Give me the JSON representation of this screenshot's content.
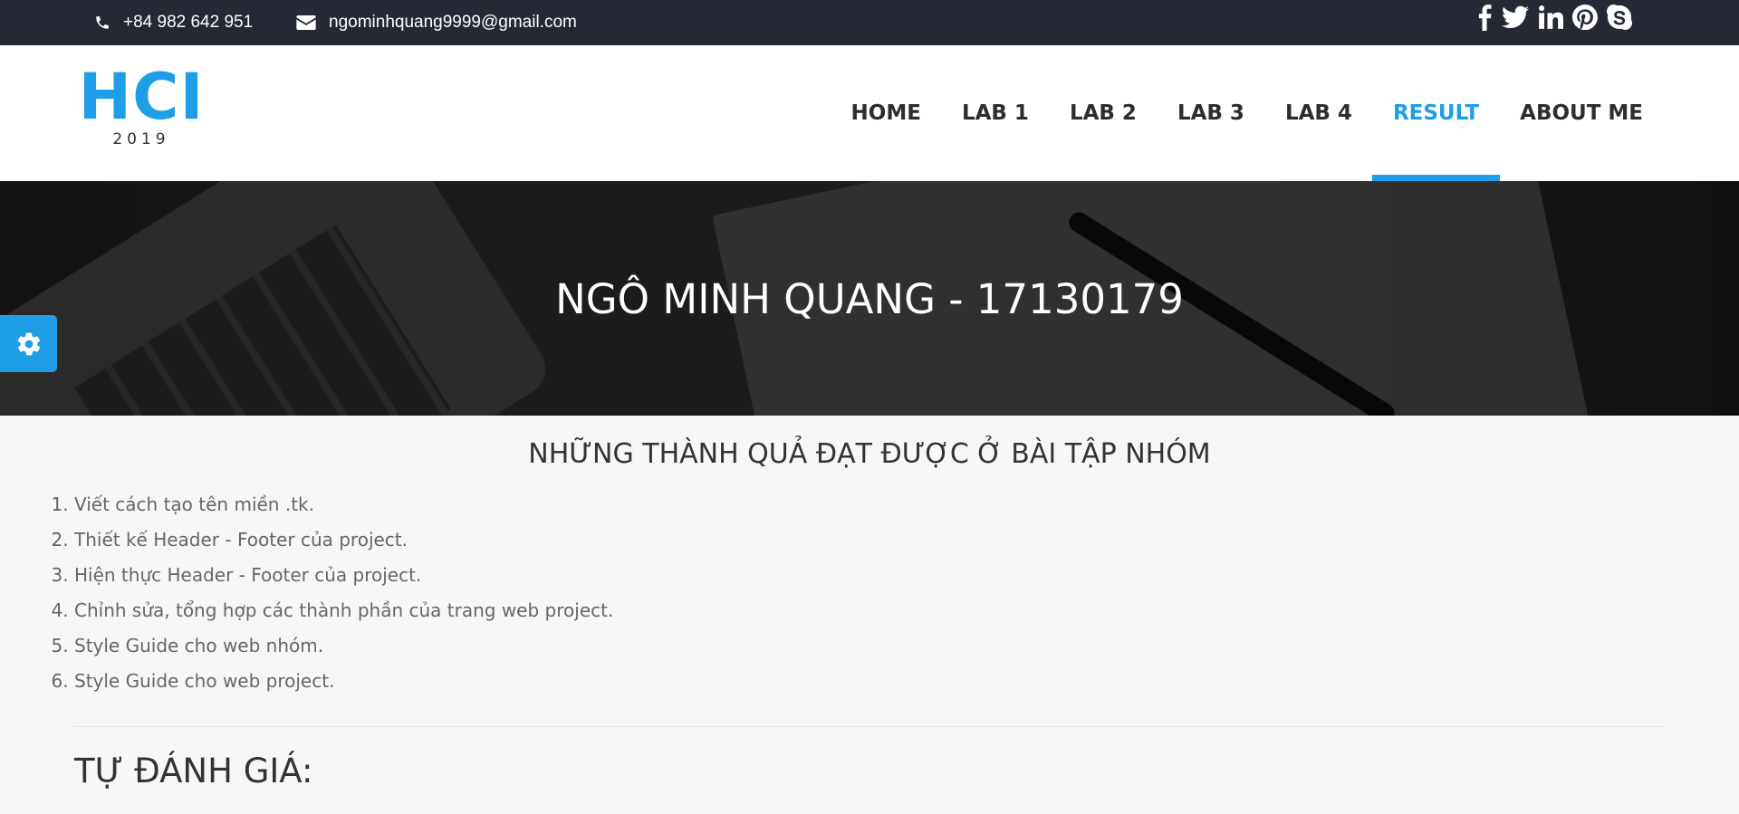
{
  "topbar": {
    "phone": "+84 982 642 951",
    "email": "ngominhquang9999@gmail.com",
    "social_icons": [
      "facebook-icon",
      "twitter-icon",
      "linkedin-icon",
      "pinterest-icon",
      "skype-icon"
    ]
  },
  "logo": {
    "main": "HCI",
    "sub": "2019"
  },
  "nav": {
    "items": [
      {
        "label": "HOME",
        "active": false
      },
      {
        "label": "LAB 1",
        "active": false
      },
      {
        "label": "LAB 2",
        "active": false
      },
      {
        "label": "LAB 3",
        "active": false
      },
      {
        "label": "LAB 4",
        "active": false
      },
      {
        "label": "RESULT",
        "active": true
      },
      {
        "label": "ABOUT ME",
        "active": false
      }
    ]
  },
  "hero": {
    "title": "NGÔ MINH QUANG - 17130179"
  },
  "content": {
    "section_title": "NHỮNG THÀNH QUẢ ĐẠT ĐƯỢC Ở BÀI TẬP NHÓM",
    "achievements": [
      "Viết cách tạo tên miền .tk.",
      "Thiết kế Header - Footer của project.",
      "Hiện thực Header - Footer của project.",
      "Chỉnh sửa, tổng hợp các thành phần của trang web project.",
      "Style Guide cho web nhóm.",
      "Style Guide cho web project."
    ],
    "self_eval_title": "TỰ ĐÁNH GIÁ:"
  },
  "colors": {
    "accent": "#1e9ee6",
    "topbar": "#262934",
    "content_bg": "#f7f7f7"
  }
}
